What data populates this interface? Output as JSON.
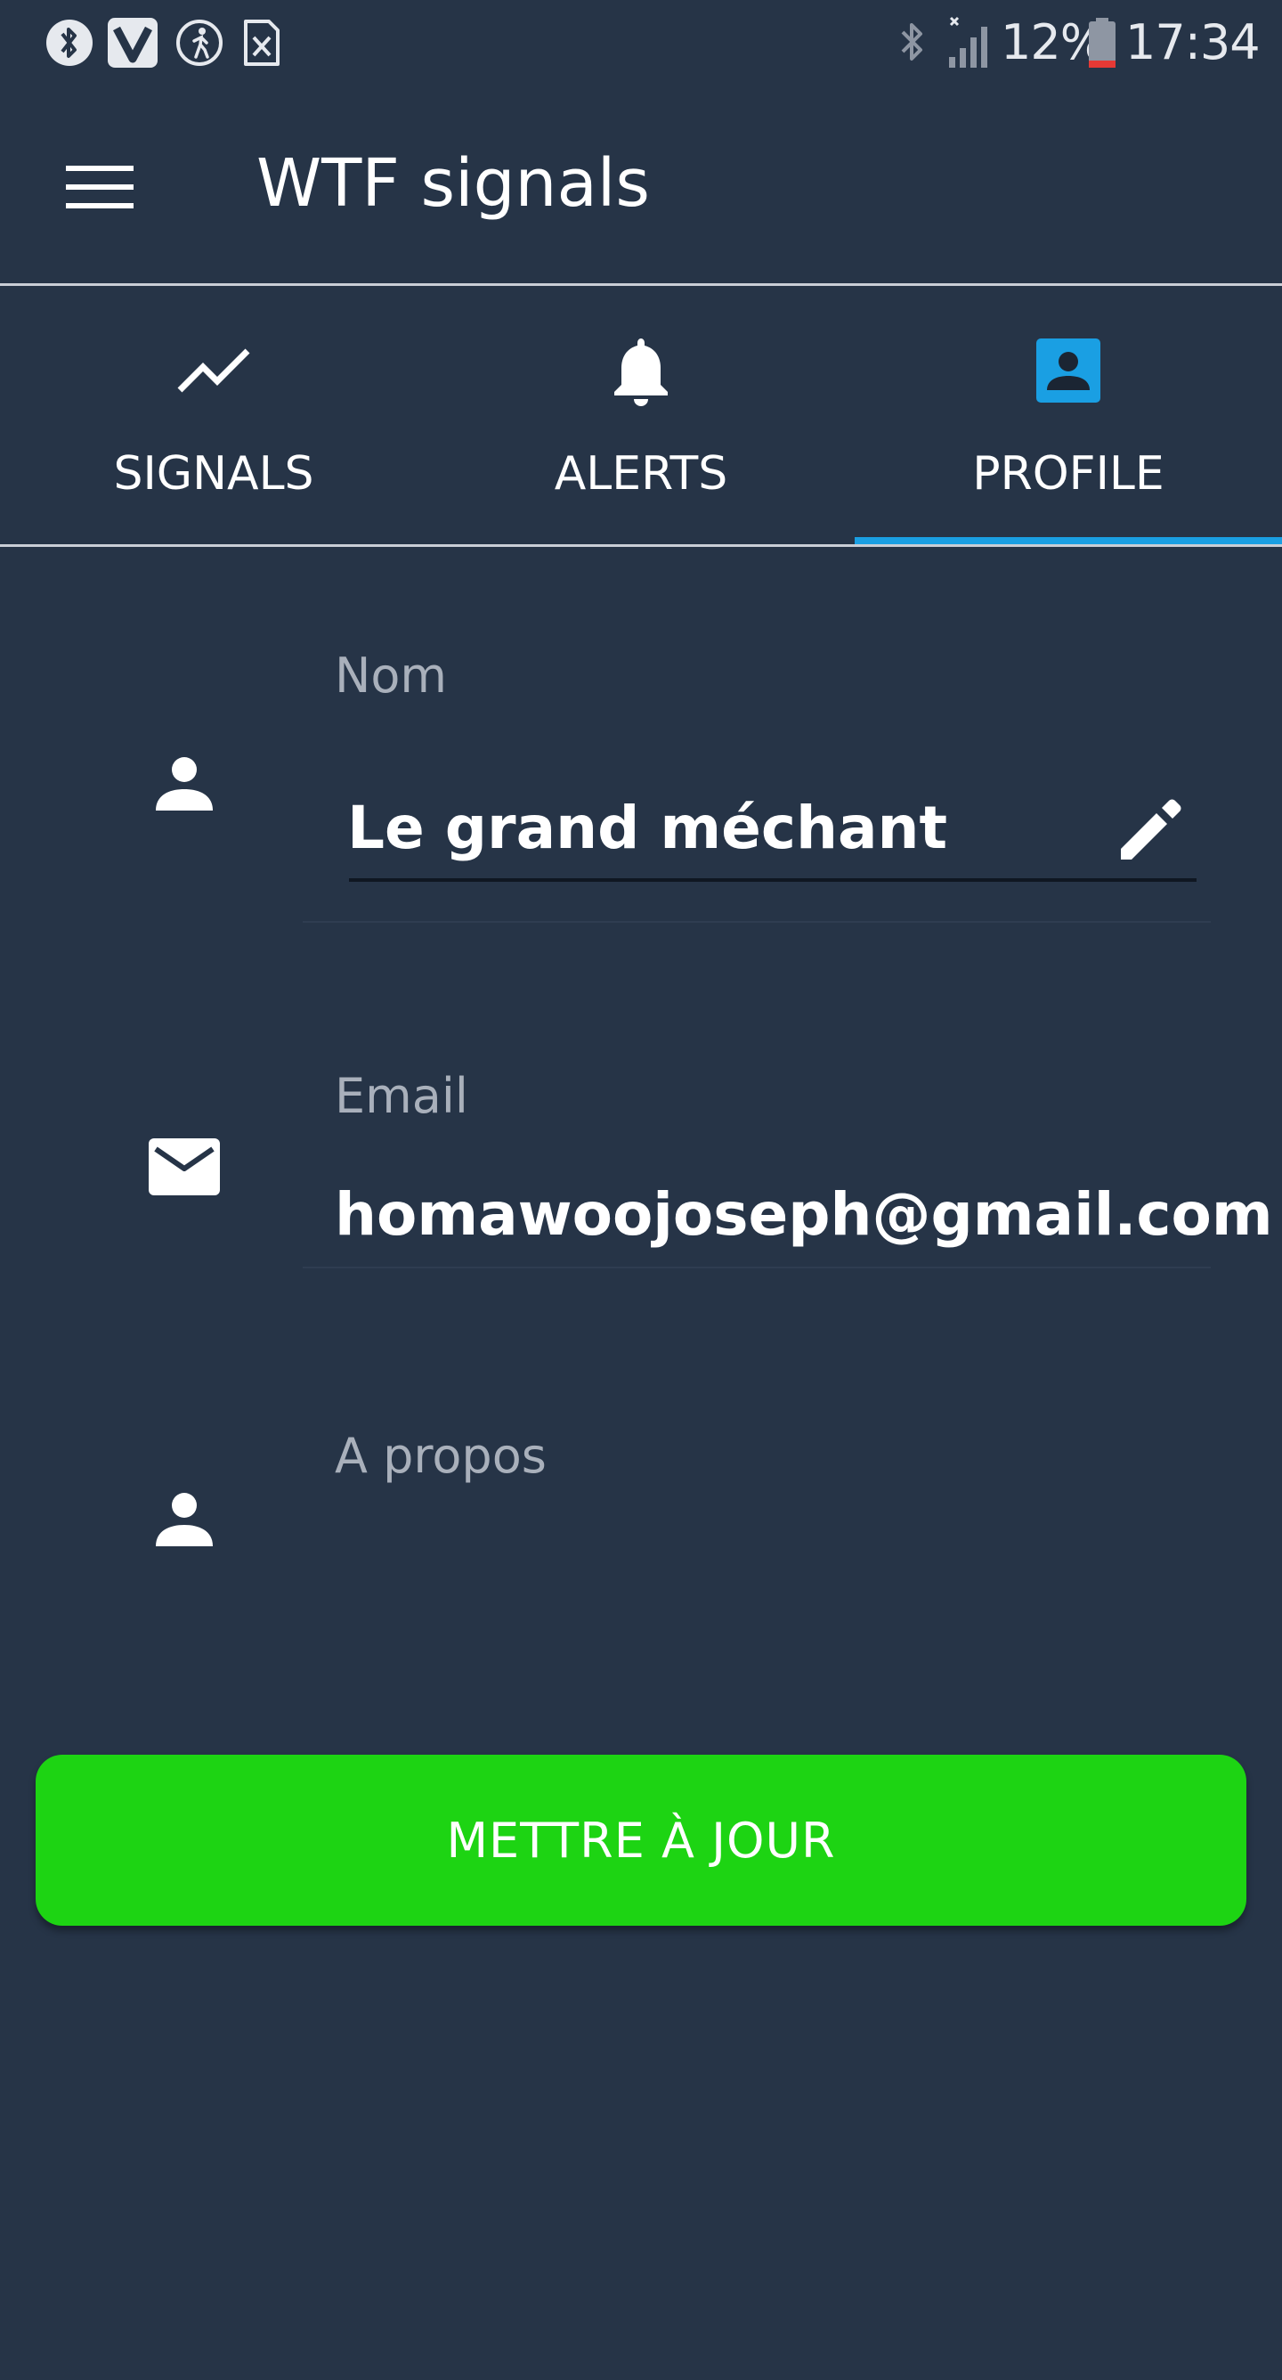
{
  "status_bar": {
    "battery_percent": "12%",
    "time": "17:34",
    "icons": [
      "bluetooth-icon",
      "v-app-icon",
      "activity-icon",
      "sim-icon",
      "bluetooth-status-icon",
      "signal-icon",
      "battery-icon"
    ]
  },
  "app_bar": {
    "title": "WTF signals",
    "menu_icon": "hamburger-menu-icon"
  },
  "tabs": [
    {
      "label": "SIGNALS",
      "icon": "trending-up-icon",
      "selected": false
    },
    {
      "label": "ALERTS",
      "icon": "bell-icon",
      "selected": false
    },
    {
      "label": "PROFILE",
      "icon": "account-box-icon",
      "selected": true
    }
  ],
  "form": {
    "name": {
      "label": "Nom",
      "value": "Le grand méchant",
      "icon": "person-icon",
      "edit_icon": "pencil-icon"
    },
    "email": {
      "label": "Email",
      "value": "homawoojoseph@gmail.com",
      "icon": "mail-icon"
    },
    "about": {
      "label": "A propos",
      "value": "",
      "icon": "person-icon"
    }
  },
  "update_button": {
    "label": "METTRE À JOUR"
  },
  "colors": {
    "background": "#263447",
    "accent_tab": "#1a9fe3",
    "button": "#1dd413",
    "label": "#a9b0bb"
  }
}
